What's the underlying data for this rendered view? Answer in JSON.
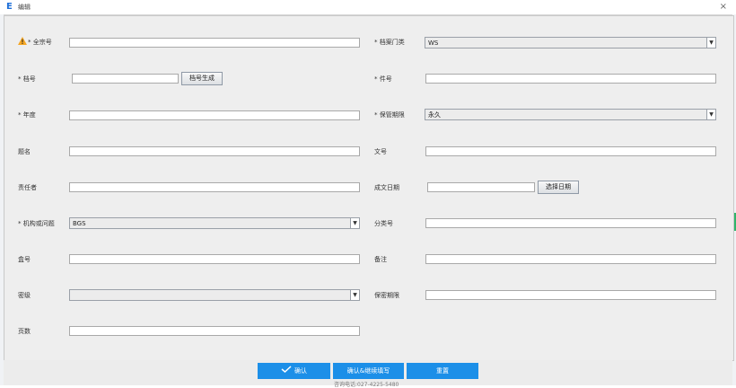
{
  "window": {
    "title": "编辑",
    "app_letter": "E",
    "close_glyph": "×"
  },
  "form": {
    "left": [
      {
        "key": "quanzong",
        "label": "* 全宗号",
        "value": "",
        "warn": true
      },
      {
        "key": "danghao",
        "label": "* 档号",
        "value": "",
        "button": "档号生成"
      },
      {
        "key": "niandu",
        "label": "* 年度",
        "value": ""
      },
      {
        "key": "timing",
        "label": "题名",
        "value": ""
      },
      {
        "key": "zerenzhe",
        "label": "责任者",
        "value": ""
      },
      {
        "key": "jigou",
        "label": "* 机构或问题",
        "value": "BGS",
        "select": true
      },
      {
        "key": "hehao",
        "label": "盒号",
        "value": ""
      },
      {
        "key": "miji",
        "label": "密级",
        "value": "",
        "select": true
      },
      {
        "key": "yeshu",
        "label": "页数",
        "value": ""
      }
    ],
    "right": [
      {
        "key": "menlei",
        "label": "* 档案门类",
        "value": "WS",
        "select": true
      },
      {
        "key": "jianhao",
        "label": "* 件号",
        "value": ""
      },
      {
        "key": "baoguan",
        "label": "* 保管期限",
        "value": "永久",
        "select": true
      },
      {
        "key": "wenhao",
        "label": "文号",
        "value": ""
      },
      {
        "key": "chengwen",
        "label": "成文日期",
        "value": "",
        "button": "选择日期"
      },
      {
        "key": "fenlei",
        "label": "分类号",
        "value": ""
      },
      {
        "key": "beizhu",
        "label": "备注",
        "value": ""
      },
      {
        "key": "baomi",
        "label": "保密期限",
        "value": ""
      }
    ]
  },
  "footer": {
    "confirm": "确认",
    "confirm_continue": "确认&继续填写",
    "reset": "重置",
    "hidden_text": "咨询电话:027-4225-5480"
  },
  "colors": {
    "primary_button": "#1c8fe8",
    "warning": "#f5a623"
  }
}
